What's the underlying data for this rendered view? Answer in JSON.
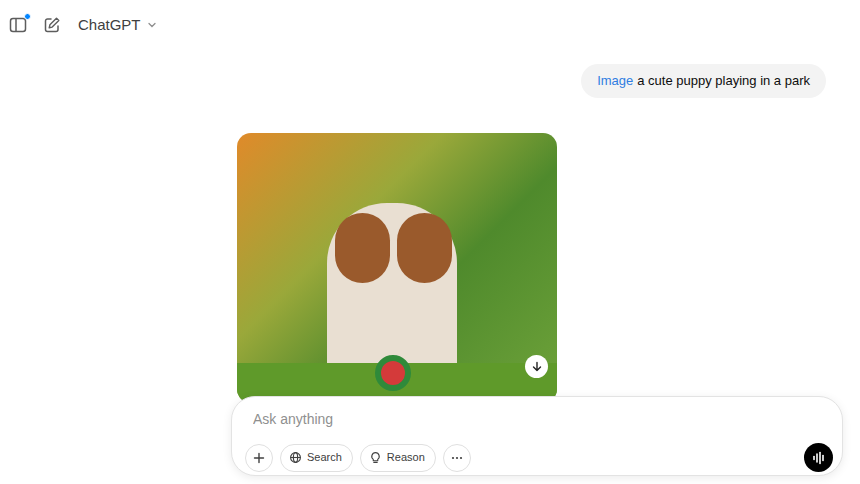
{
  "header": {
    "title": "ChatGPT",
    "notification": true
  },
  "message": {
    "tag": "Image",
    "text": "a cute puppy playing in a park"
  },
  "composer": {
    "placeholder": "Ask anything",
    "tools": [
      "Search",
      "Reason"
    ]
  }
}
